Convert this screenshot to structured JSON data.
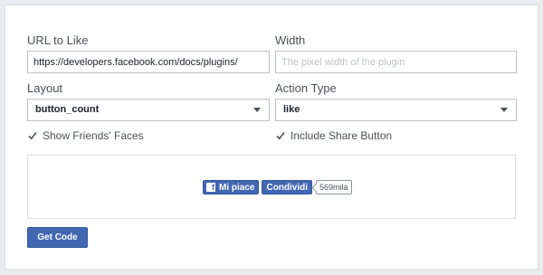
{
  "form": {
    "url_label": "URL to Like",
    "url_value": "https://developers.facebook.com/docs/plugins/",
    "width_label": "Width",
    "width_placeholder": "The pixel width of the plugin",
    "layout_label": "Layout",
    "layout_value": "button_count",
    "action_label": "Action Type",
    "action_value": "like",
    "show_faces_label": "Show Friends' Faces",
    "show_faces_checked": true,
    "include_share_label": "Include Share Button",
    "include_share_checked": true
  },
  "preview": {
    "like_label": "Mi piace",
    "share_label": "Condividi",
    "count": "569mila",
    "logo_letter": "f"
  },
  "actions": {
    "get_code_label": "Get Code"
  },
  "colors": {
    "accent": "#4267b2",
    "border": "#bdc1c9",
    "background": "#e9ebee"
  }
}
